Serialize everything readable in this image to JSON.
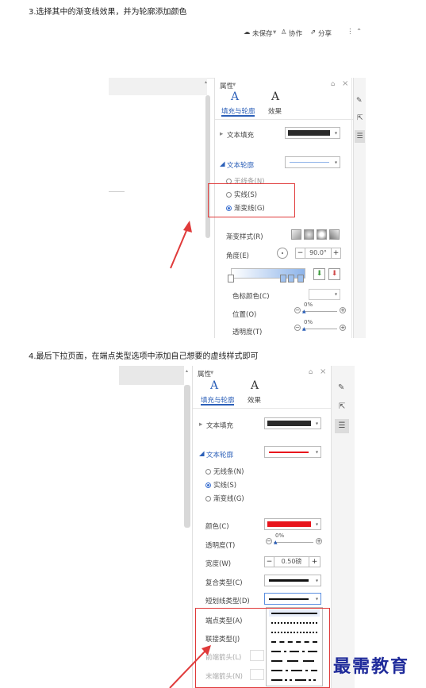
{
  "step3": {
    "text": "3.选择其中的渐变线效果，并为轮廓添加颜色"
  },
  "topbar": {
    "unsaved": "未保存",
    "collaborate": "协作",
    "share": "分享"
  },
  "panel1": {
    "title": "属性",
    "tab_fill": "填充与轮廓",
    "tab_effect": "效果",
    "text_fill": "文本填充",
    "text_outline": "文本轮廓",
    "opt_none": "无线条(N)",
    "opt_solid": "实线(S)",
    "opt_gradient": "渐变线(G)",
    "gradient_style": "渐变样式(R)",
    "angle": "角度(E)",
    "angle_value": "90.0°",
    "stop_color": "色标颜色(C)",
    "position": "位置(O)",
    "position_value": "0%",
    "transparency": "透明度(T)",
    "transparency_value": "0%"
  },
  "step4": {
    "text": "4.最后下拉页面，在端点类型选项中添加自己想要的虚线样式即可"
  },
  "panel2": {
    "title": "属性",
    "tab_fill": "填充与轮廓",
    "tab_effect": "效果",
    "text_fill": "文本填充",
    "text_outline": "文本轮廓",
    "opt_none": "无线条(N)",
    "opt_solid": "实线(S)",
    "opt_gradient": "渐变线(G)",
    "color": "颜色(C)",
    "transparency": "透明度(T)",
    "transparency_value": "0%",
    "width": "宽度(W)",
    "width_value": "0.50磅",
    "compound": "复合类型(C)",
    "dash": "短划线类型(D)",
    "cap": "端点类型(A)",
    "join": "联接类型(J)",
    "begin_arrow": "前端箭头(L)",
    "end_arrow": "末端箭头(N)"
  },
  "watermark": {
    "text": "最需教育"
  },
  "colors": {
    "outline_red": "#e8141c",
    "fill_dark": "#2b2b2b",
    "accent_blue": "#2b5fb8",
    "highlight_red": "#e03a3a"
  }
}
